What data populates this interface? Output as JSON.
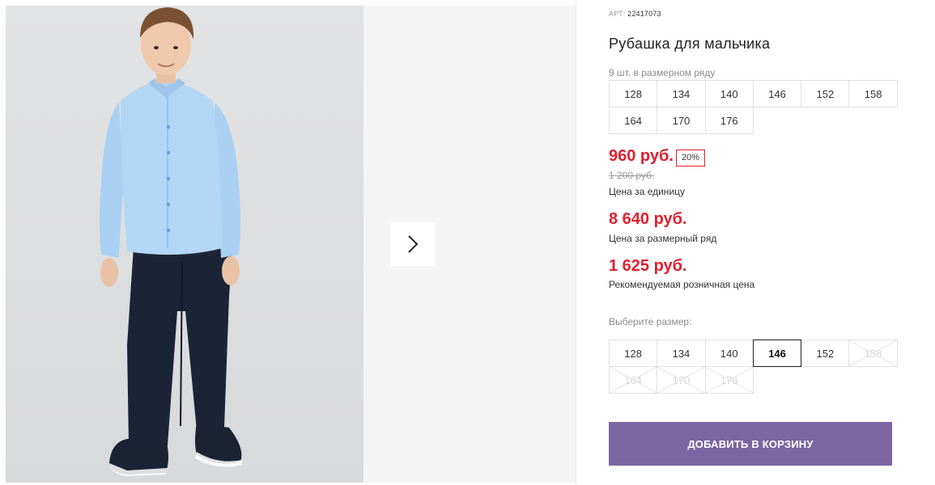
{
  "product": {
    "art_label": "АРТ:",
    "art_number": "22417073",
    "title": "Рубашка для мальчика",
    "pack_note": "9 шт. в размерном ряду",
    "pack_sizes": [
      "128",
      "134",
      "140",
      "146",
      "152",
      "158",
      "164",
      "170",
      "176"
    ]
  },
  "prices": {
    "unit_price": "960 руб.",
    "discount": "20%",
    "old_price": "1 200 руб.",
    "unit_label": "Цена за единицу",
    "pack_price": "8 640 руб.",
    "pack_label": "Цена за размерный ряд",
    "retail_price": "1 625 руб.",
    "retail_label": "Рекомендуемая розничная цена"
  },
  "size_picker": {
    "label": "Выберите размер:",
    "options": [
      {
        "size": "128",
        "state": "available"
      },
      {
        "size": "134",
        "state": "available"
      },
      {
        "size": "140",
        "state": "available"
      },
      {
        "size": "146",
        "state": "selected"
      },
      {
        "size": "152",
        "state": "available"
      },
      {
        "size": "158",
        "state": "unavailable"
      },
      {
        "size": "164",
        "state": "unavailable"
      },
      {
        "size": "170",
        "state": "unavailable"
      },
      {
        "size": "176",
        "state": "unavailable"
      }
    ]
  },
  "cart": {
    "add_label": "ДОБАВИТЬ В КОРЗИНУ"
  },
  "gallery": {
    "next_icon": "chevron-right-icon"
  },
  "colors": {
    "price_red": "#e0202e",
    "button_purple": "#7b65a3",
    "shirt_blue": "#a9d0f2",
    "trousers_navy": "#1b2436"
  }
}
